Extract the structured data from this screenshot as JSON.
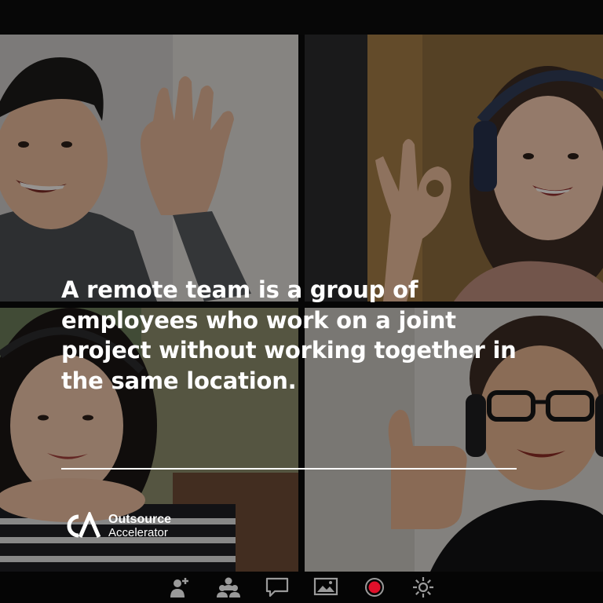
{
  "headline": "A remote team is a group of employees who work on a joint project without working together in the same location.",
  "brand": {
    "line1": "Outsource",
    "line2": "Accelerator",
    "logo_icon": "ca-monogram-icon"
  },
  "participants": [
    {
      "tile": "top-left",
      "description_icon": "participant-waving"
    },
    {
      "tile": "top-right",
      "description_icon": "participant-ok-gesture-headphones"
    },
    {
      "tile": "bottom-left",
      "description_icon": "participant-chin-on-hands"
    },
    {
      "tile": "bottom-right",
      "description_icon": "participant-thumbs-up-glasses"
    }
  ],
  "toolbar": {
    "icons": [
      "add-participant-icon",
      "participants-icon",
      "chat-icon",
      "share-screen-icon",
      "record-icon",
      "settings-icon"
    ]
  },
  "colors": {
    "background": "#0b0b0b",
    "text": "#ffffff",
    "record": "#e0102a",
    "toolbar_icon": "#9a9a9a"
  }
}
